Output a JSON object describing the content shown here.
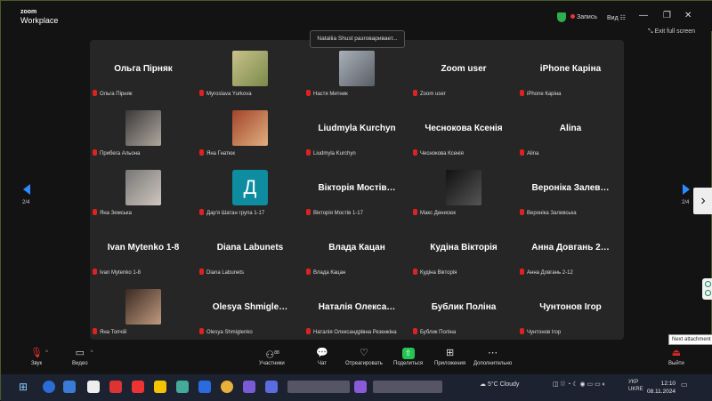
{
  "app": {
    "logo_line1": "zoom",
    "logo_line2": "Workplace"
  },
  "titlebar": {
    "record_label": "Запись",
    "view_label": "Вид",
    "view_icon": "grid-icon",
    "minimize": "—",
    "maximize": "❐",
    "close": "✕"
  },
  "exit_fullscreen": "Exit full screen",
  "speaking_tooltip": "Nataliia Shust разговаривает...",
  "grid": {
    "tiles": [
      {
        "big": "Ольга Пірняк",
        "label": "Ольга Пірняк"
      },
      {
        "big": "",
        "label": "Myroslava Yurkova"
      },
      {
        "big": "",
        "label": "Настя Митник"
      },
      {
        "big": "Zoom user",
        "label": "Zoom user"
      },
      {
        "big": "iPhone Каріна",
        "label": "iPhone Каріна"
      },
      {
        "big": "",
        "label": "Прибега Альона"
      },
      {
        "big": "",
        "label": "Яна Гнатюк"
      },
      {
        "big": "Liudmyla Kurchyn",
        "label": "Liudmyla Kurchyn"
      },
      {
        "big": "Чеснокова Ксенія",
        "label": "Чеснокова Ксенія"
      },
      {
        "big": "Alina",
        "label": "Alina"
      },
      {
        "big": "",
        "label": "Яна Земська"
      },
      {
        "big": "",
        "letter": "Д",
        "label": "Дар'я Шатан група 1-17"
      },
      {
        "big": "Вікторія Мостів…",
        "label": "Вікторія Мостів 1-17"
      },
      {
        "big": "",
        "label": "Макс Денисюк"
      },
      {
        "big": "Вероніка Залев…",
        "label": "Вероніка Залевська"
      },
      {
        "big": "Ivan Mytenko 1-8",
        "label": "Ivan Mytenko 1-8"
      },
      {
        "big": "Diana Labunets",
        "label": "Diana Labunets"
      },
      {
        "big": "Влада Кацан",
        "label": "Влада Кацан"
      },
      {
        "big": "Кудіна Вікторія",
        "label": "Кудіна Вікторія"
      },
      {
        "big": "Анна Довгань 2…",
        "label": "Анна Довгань 2-12"
      },
      {
        "big": "",
        "label": "Яна Топчій"
      },
      {
        "big": "Olesya Shmigle…",
        "label": "Olesya Shmiglenko"
      },
      {
        "big": "Наталія Олекса…",
        "label": "Наталія Олександрівна Резенкіна"
      },
      {
        "big": "Бублик Поліна",
        "label": "Бублик Поліна"
      },
      {
        "big": "Чунтонов Ігор",
        "label": "Чунтонов Ігор"
      }
    ]
  },
  "pagination": {
    "left": "2/4",
    "right": "2/4"
  },
  "next_attachment": "Next attachment",
  "toolbar": {
    "audio": "Звук",
    "video": "Видео",
    "participants": "Участники",
    "participants_count": "88",
    "chat": "Чат",
    "react": "Отреагировать",
    "share": "Поделиться",
    "apps": "Приложения",
    "more": "Дополнительно",
    "leave": "Выйти"
  },
  "taskbar": {
    "weather": "5°C  Cloudy",
    "lang1": "УКР",
    "lang2": "UKRE",
    "time": "12:10",
    "date": "08.11.2024"
  },
  "colors": {
    "accent": "#2a8cff",
    "bg": "#131313",
    "grid_bg": "#262626",
    "share": "#23c552",
    "leave": "#e02828"
  }
}
